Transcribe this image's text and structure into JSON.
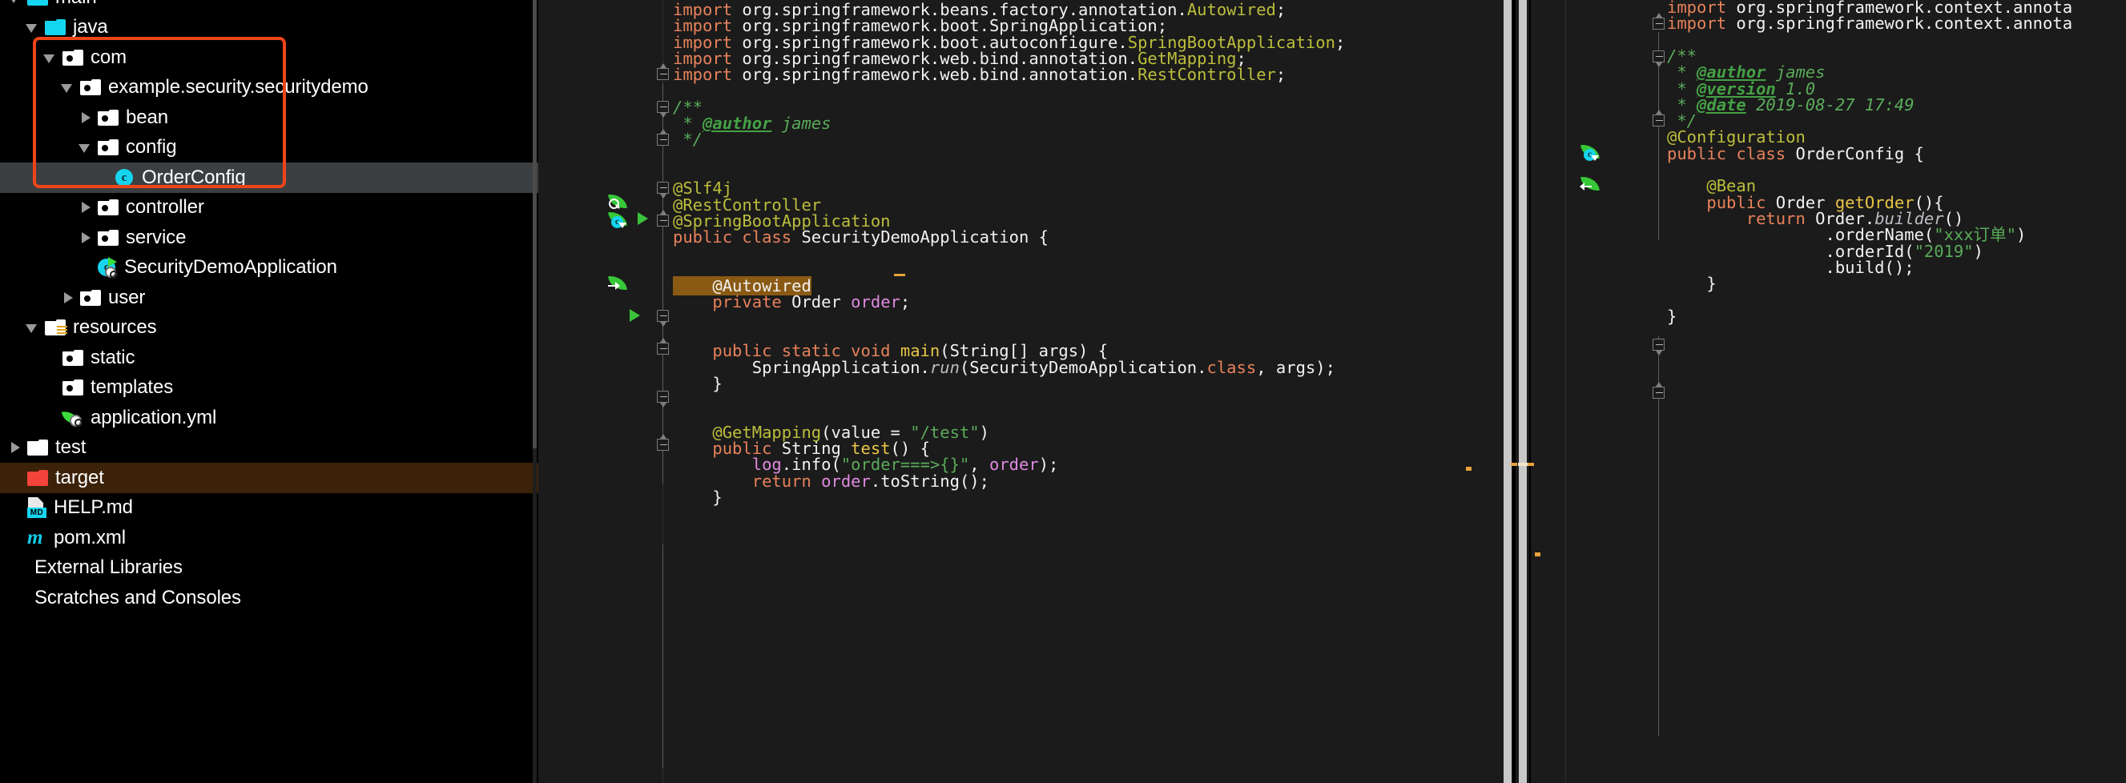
{
  "project_tree": {
    "name": "project-tree",
    "rows": [
      {
        "label": "main",
        "indent": 1,
        "twisty": "expanded",
        "icon": "folder-cyan",
        "state": "partial-top"
      },
      {
        "label": "java",
        "indent": 2,
        "twisty": "expanded",
        "icon": "folder-cyan",
        "state": "normal"
      },
      {
        "label": "com",
        "indent": 3,
        "twisty": "expanded",
        "icon": "folder-package",
        "state": "normal"
      },
      {
        "label": "example.security.securitydemo",
        "indent": 4,
        "twisty": "expanded",
        "icon": "folder-package",
        "state": "normal"
      },
      {
        "label": "bean",
        "indent": 5,
        "twisty": "collapsed",
        "icon": "folder-package",
        "state": "normal"
      },
      {
        "label": "config",
        "indent": 5,
        "twisty": "expanded",
        "icon": "folder-package",
        "state": "normal"
      },
      {
        "label": "OrderConfig",
        "indent": 6,
        "twisty": "none",
        "icon": "java-class",
        "state": "selected"
      },
      {
        "label": "controller",
        "indent": 5,
        "twisty": "collapsed",
        "icon": "folder-package",
        "state": "normal"
      },
      {
        "label": "service",
        "indent": 5,
        "twisty": "collapsed",
        "icon": "folder-package",
        "state": "normal"
      },
      {
        "label": "SecurityDemoApplication",
        "indent": 5,
        "twisty": "none",
        "icon": "spring-boot-class",
        "state": "normal"
      },
      {
        "label": "user",
        "indent": 4,
        "twisty": "collapsed",
        "icon": "folder-package",
        "state": "normal"
      },
      {
        "label": "resources",
        "indent": 2,
        "twisty": "expanded",
        "icon": "folder-resources",
        "state": "normal"
      },
      {
        "label": "static",
        "indent": 3,
        "twisty": "none",
        "icon": "folder-package",
        "state": "normal"
      },
      {
        "label": "templates",
        "indent": 3,
        "twisty": "none",
        "icon": "folder-package",
        "state": "normal"
      },
      {
        "label": "application.yml",
        "indent": 3,
        "twisty": "none",
        "icon": "spring-yml",
        "state": "normal"
      },
      {
        "label": "test",
        "indent": 1,
        "twisty": "collapsed",
        "icon": "folder-plain",
        "state": "normal"
      },
      {
        "label": "target",
        "indent": 1,
        "twisty": "none",
        "icon": "folder-red",
        "state": "target-highlight"
      },
      {
        "label": "HELP.md",
        "indent": 1,
        "twisty": "none",
        "icon": "markdown-file",
        "state": "normal"
      },
      {
        "label": "pom.xml",
        "indent": 1,
        "twisty": "none",
        "icon": "maven-file",
        "state": "normal"
      },
      {
        "label": "External Libraries",
        "indent": 1,
        "twisty": "none",
        "icon": "none",
        "state": "normal"
      },
      {
        "label": "Scratches and Consoles",
        "indent": 1,
        "twisty": "none",
        "icon": "none",
        "state": "normal"
      }
    ],
    "annotation": {
      "name": "red-highlight-box",
      "color": "#ee4518"
    },
    "md_badge": "MD",
    "maven_glyph": "m",
    "class_glyph": "c"
  },
  "editor_main": {
    "file": "SecurityDemoApplication.java",
    "lines": [
      {
        "segments": [
          {
            "t": "import ",
            "c": "kw"
          },
          {
            "t": "org.springframework.beans.factory.annotation.",
            "c": "plain"
          },
          {
            "t": "Autowired",
            "c": "anno"
          },
          {
            "t": ";",
            "c": "plain"
          }
        ]
      },
      {
        "segments": [
          {
            "t": "import ",
            "c": "kw"
          },
          {
            "t": "org.springframework.boot.SpringApplication",
            "c": "plain"
          },
          {
            "t": ";",
            "c": "plain"
          }
        ]
      },
      {
        "segments": [
          {
            "t": "import ",
            "c": "kw"
          },
          {
            "t": "org.springframework.boot.autoconfigure.",
            "c": "plain"
          },
          {
            "t": "SpringBootApplication",
            "c": "anno"
          },
          {
            "t": ";",
            "c": "plain"
          }
        ]
      },
      {
        "segments": [
          {
            "t": "import ",
            "c": "kw"
          },
          {
            "t": "org.springframework.web.bind.annotation.",
            "c": "plain"
          },
          {
            "t": "GetMapping",
            "c": "anno"
          },
          {
            "t": ";",
            "c": "plain"
          }
        ]
      },
      {
        "segments": [
          {
            "t": "import ",
            "c": "kw"
          },
          {
            "t": "org.springframework.web.bind.annotation.",
            "c": "plain"
          },
          {
            "t": "RestController",
            "c": "anno"
          },
          {
            "t": ";",
            "c": "plain"
          }
        ]
      },
      {
        "segments": []
      },
      {
        "segments": [
          {
            "t": "/**",
            "c": "cmt"
          }
        ]
      },
      {
        "segments": [
          {
            "t": " * ",
            "c": "cmt"
          },
          {
            "t": "@author",
            "c": "cmtt"
          },
          {
            "t": " james",
            "c": "cmt"
          }
        ]
      },
      {
        "segments": [
          {
            "t": " */",
            "c": "cmt"
          }
        ]
      },
      {
        "segments": []
      },
      {
        "segments": []
      },
      {
        "segments": [
          {
            "t": "@Slf4j",
            "c": "anno"
          }
        ]
      },
      {
        "segments": [
          {
            "t": "@RestController",
            "c": "anno"
          }
        ]
      },
      {
        "segments": [
          {
            "t": "@SpringBootApplication",
            "c": "anno"
          }
        ]
      },
      {
        "segments": [
          {
            "t": "public class ",
            "c": "kw"
          },
          {
            "t": "SecurityDemoApplication",
            "c": "plain"
          },
          {
            "t": " {",
            "c": "plain"
          }
        ]
      },
      {
        "segments": []
      },
      {
        "segments": []
      },
      {
        "segments": [
          {
            "t": "    @Autowired",
            "c": "hl-autowired"
          }
        ]
      },
      {
        "segments": [
          {
            "t": "    private ",
            "c": "kw"
          },
          {
            "t": "Order ",
            "c": "plain"
          },
          {
            "t": "order",
            "c": "fld"
          },
          {
            "t": ";",
            "c": "plain"
          }
        ]
      },
      {
        "segments": []
      },
      {
        "segments": []
      },
      {
        "segments": [
          {
            "t": "    public static void ",
            "c": "kw"
          },
          {
            "t": "main",
            "c": "mth"
          },
          {
            "t": "(",
            "c": "plain"
          },
          {
            "t": "String[] args",
            "c": "plain"
          },
          {
            "t": ") {",
            "c": "plain"
          }
        ]
      },
      {
        "segments": [
          {
            "t": "        SpringApplication.",
            "c": "plain"
          },
          {
            "t": "run",
            "c": "itl"
          },
          {
            "t": "(SecurityDemoApplication.",
            "c": "plain"
          },
          {
            "t": "class",
            "c": "kw"
          },
          {
            "t": ", args);",
            "c": "plain"
          }
        ]
      },
      {
        "segments": [
          {
            "t": "    }",
            "c": "plain"
          }
        ]
      },
      {
        "segments": []
      },
      {
        "segments": []
      },
      {
        "segments": [
          {
            "t": "    @GetMapping",
            "c": "anno"
          },
          {
            "t": "(value = ",
            "c": "plain"
          },
          {
            "t": "\"/test\"",
            "c": "str"
          },
          {
            "t": ")",
            "c": "plain"
          }
        ]
      },
      {
        "segments": [
          {
            "t": "    public ",
            "c": "kw"
          },
          {
            "t": "String ",
            "c": "plain"
          },
          {
            "t": "test",
            "c": "mth"
          },
          {
            "t": "() {",
            "c": "plain"
          }
        ]
      },
      {
        "segments": [
          {
            "t": "        ",
            "c": "plain"
          },
          {
            "t": "log",
            "c": "fld"
          },
          {
            "t": ".info(",
            "c": "plain"
          },
          {
            "t": "\"order===>{}\"",
            "c": "str"
          },
          {
            "t": ", ",
            "c": "plain"
          },
          {
            "t": "order",
            "c": "fld"
          },
          {
            "t": ");",
            "c": "plain"
          }
        ]
      },
      {
        "segments": [
          {
            "t": "        return ",
            "c": "kw"
          },
          {
            "t": "order",
            "c": "fld"
          },
          {
            "t": ".toString();",
            "c": "plain"
          }
        ]
      },
      {
        "segments": [
          {
            "t": "    }",
            "c": "plain"
          }
        ]
      }
    ]
  },
  "editor_side": {
    "file": "OrderConfig.java",
    "lines": [
      {
        "segments": [
          {
            "t": "import ",
            "c": "kw"
          },
          {
            "t": "org.springframework.context.annota",
            "c": "plain"
          }
        ]
      },
      {
        "segments": [
          {
            "t": "import ",
            "c": "kw"
          },
          {
            "t": "org.springframework.context.annota",
            "c": "plain"
          }
        ]
      },
      {
        "segments": []
      },
      {
        "segments": [
          {
            "t": "/**",
            "c": "cmt"
          }
        ]
      },
      {
        "segments": [
          {
            "t": " * ",
            "c": "cmt"
          },
          {
            "t": "@author",
            "c": "cmtt"
          },
          {
            "t": " james",
            "c": "cmt"
          }
        ]
      },
      {
        "segments": [
          {
            "t": " * ",
            "c": "cmt"
          },
          {
            "t": "@version",
            "c": "cmtt"
          },
          {
            "t": " 1.0",
            "c": "cmt"
          }
        ]
      },
      {
        "segments": [
          {
            "t": " * ",
            "c": "cmt"
          },
          {
            "t": "@date",
            "c": "cmtt"
          },
          {
            "t": " 2019-08-27 17:49",
            "c": "cmt"
          }
        ]
      },
      {
        "segments": [
          {
            "t": " */",
            "c": "cmt"
          }
        ]
      },
      {
        "segments": [
          {
            "t": "@Configuration",
            "c": "anno"
          }
        ]
      },
      {
        "segments": [
          {
            "t": "public class ",
            "c": "kw"
          },
          {
            "t": "OrderConfig",
            "c": "plain"
          },
          {
            "t": " {",
            "c": "plain"
          }
        ]
      },
      {
        "segments": []
      },
      {
        "segments": [
          {
            "t": "    @Bean",
            "c": "anno"
          }
        ]
      },
      {
        "segments": [
          {
            "t": "    public ",
            "c": "kw"
          },
          {
            "t": "Order ",
            "c": "plain"
          },
          {
            "t": "getOrder",
            "c": "mth"
          },
          {
            "t": "(){",
            "c": "plain"
          }
        ]
      },
      {
        "segments": [
          {
            "t": "        return ",
            "c": "kw"
          },
          {
            "t": "Order.",
            "c": "plain"
          },
          {
            "t": "builder",
            "c": "itl"
          },
          {
            "t": "()",
            "c": "plain"
          }
        ]
      },
      {
        "segments": [
          {
            "t": "                .orderName(",
            "c": "plain"
          },
          {
            "t": "\"xxx订单\"",
            "c": "str"
          },
          {
            "t": ")",
            "c": "plain"
          }
        ]
      },
      {
        "segments": [
          {
            "t": "                .orderId(",
            "c": "plain"
          },
          {
            "t": "\"2019\"",
            "c": "str"
          },
          {
            "t": ")",
            "c": "plain"
          }
        ]
      },
      {
        "segments": [
          {
            "t": "                .build();",
            "c": "plain"
          }
        ]
      },
      {
        "segments": [
          {
            "t": "    }",
            "c": "plain"
          }
        ]
      },
      {
        "segments": []
      },
      {
        "segments": [
          {
            "t": "}",
            "c": "plain"
          }
        ]
      }
    ]
  },
  "colors": {
    "background": "#000000",
    "editor_background": "#1b1b1b",
    "selection": "#3c3f41",
    "annotation_red": "#ee4518",
    "keyword_orange": "#e8825b",
    "annotation_yellow": "#bcbe3c",
    "comment_green": "#5aab5a",
    "string_green": "#5aab5a",
    "field_pink": "#e08ae0",
    "method_yellow": "#e8c547",
    "highlight_brown": "#8a5a14",
    "target_row": "#3b2209",
    "scrollbar_thumb": "#c8c8c8",
    "marker_orange": "#e8a33d"
  }
}
